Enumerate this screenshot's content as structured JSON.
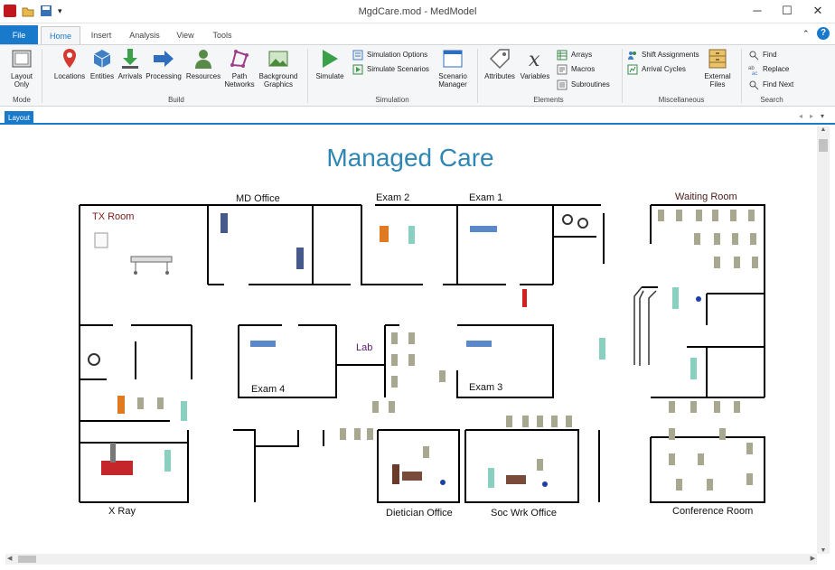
{
  "window": {
    "title": "MgdCare.mod - MedModel"
  },
  "tabs": [
    "File",
    "Home",
    "Insert",
    "Analysis",
    "View",
    "Tools"
  ],
  "ribbon": {
    "mode": {
      "layout_only": "Layout\nOnly",
      "group": "Mode"
    },
    "build": {
      "locations": "Locations",
      "entities": "Entities",
      "arrivals": "Arrivals",
      "processing": "Processing",
      "resources": "Resources",
      "path_networks": "Path\nNetworks",
      "background_graphics": "Background\nGraphics",
      "group": "Build"
    },
    "simulation": {
      "simulate": "Simulate",
      "options": "Simulation Options",
      "scenarios": "Simulate Scenarios",
      "manager": "Scenario\nManager",
      "group": "Simulation"
    },
    "elements": {
      "attributes": "Attributes",
      "variables": "Variables",
      "arrays": "Arrays",
      "macros": "Macros",
      "subroutines": "Subroutines",
      "group": "Elements"
    },
    "misc": {
      "shift": "Shift Assignments",
      "cycles": "Arrival Cycles",
      "external": "External\nFiles",
      "group": "Miscellaneous"
    },
    "search": {
      "find": "Find",
      "replace": "Replace",
      "find_next": "Find Next",
      "group": "Search"
    }
  },
  "doc_tab": "Layout",
  "layout": {
    "title": "Managed Care",
    "rooms": {
      "tx_room": "TX Room",
      "md_office": "MD Office",
      "exam2": "Exam 2",
      "exam1": "Exam 1",
      "waiting": "Waiting Room",
      "lab": "Lab",
      "exam4": "Exam 4",
      "exam3": "Exam 3",
      "xray": "X Ray",
      "dietician": "Dietician Office",
      "soc_wrk": "Soc Wrk Office",
      "conference": "Conference Room"
    }
  },
  "colors": {
    "accent": "#1979ca",
    "title_text": "#2e87b3",
    "wall": "#000000",
    "tx_label": "#7b1a1a",
    "lab_label": "#5a1a6a"
  }
}
